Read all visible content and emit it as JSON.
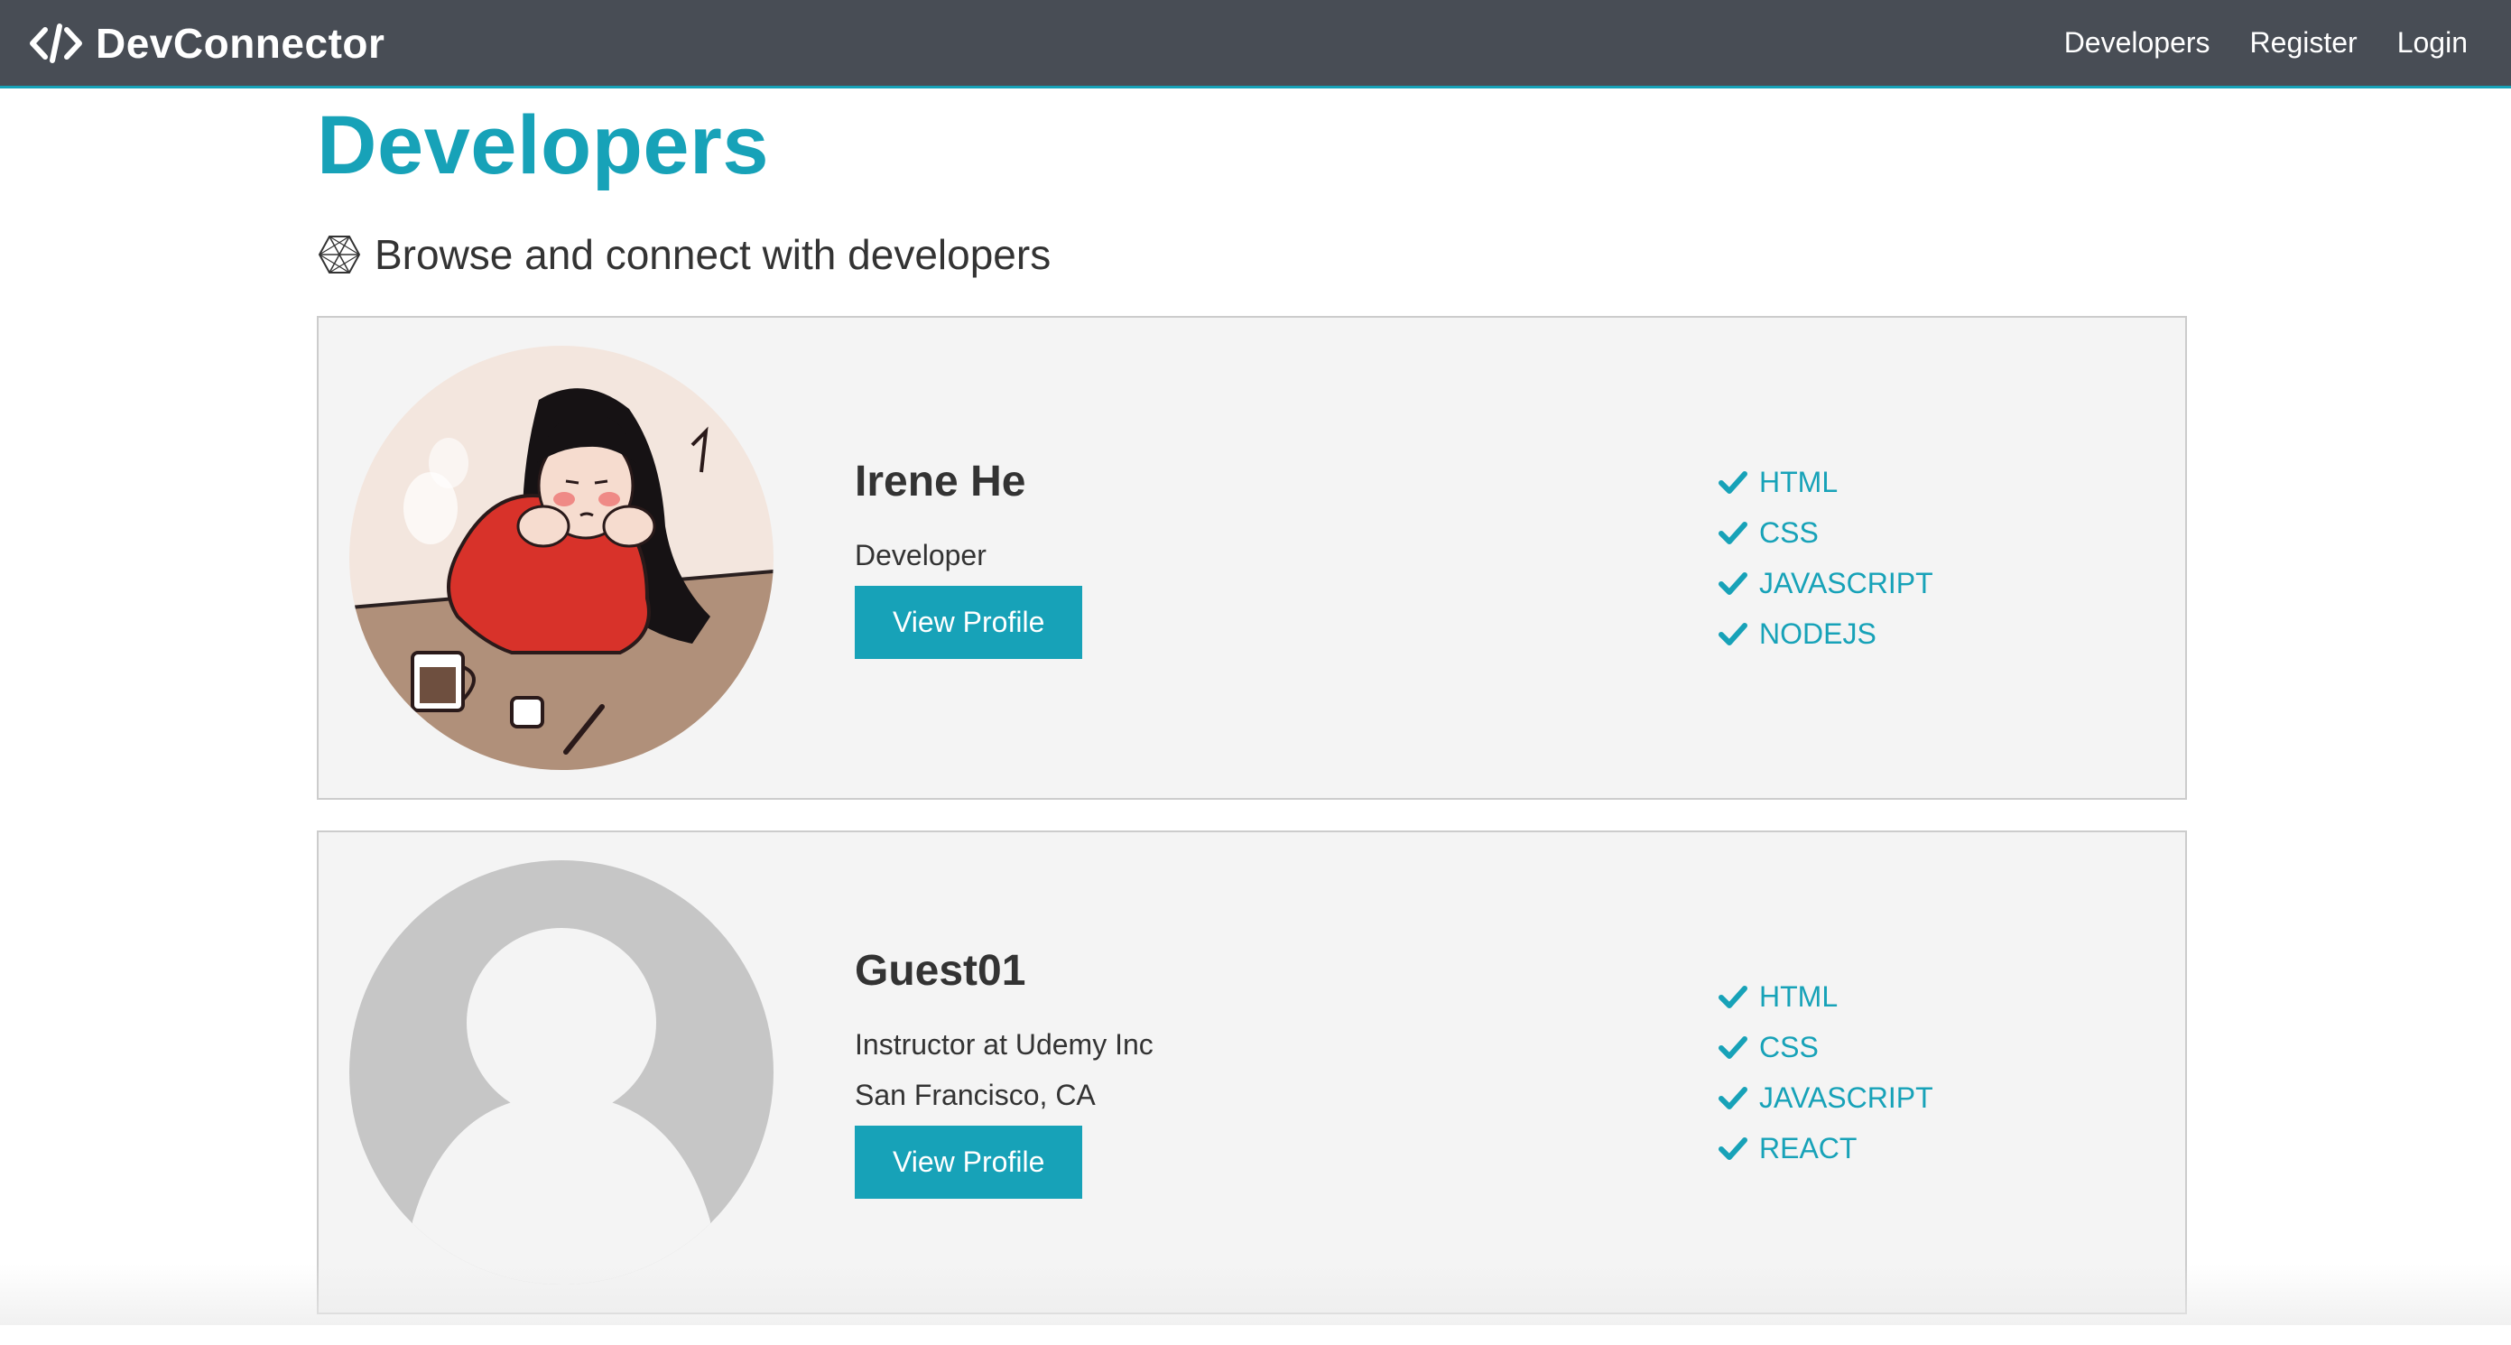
{
  "navbar": {
    "brand": "DevConnector",
    "links": [
      "Developers",
      "Register",
      "Login"
    ]
  },
  "page": {
    "title": "Developers",
    "lead": "Browse and connect with developers",
    "accent_color": "#17a2b8",
    "navbar_color": "#484d55"
  },
  "profiles": [
    {
      "name": "Irene He",
      "status": "Developer",
      "location": "",
      "button": "View Profile",
      "avatar": "illustrated-girl-avatar",
      "skills": [
        "HTML",
        "CSS",
        "JAVASCRIPT",
        "NODEJS"
      ]
    },
    {
      "name": "Guest01",
      "status": "Instructor at Udemy Inc",
      "location": "San Francisco, CA",
      "button": "View Profile",
      "avatar": "default-user-avatar",
      "skills": [
        "HTML",
        "CSS",
        "JAVASCRIPT",
        "REACT"
      ]
    }
  ]
}
